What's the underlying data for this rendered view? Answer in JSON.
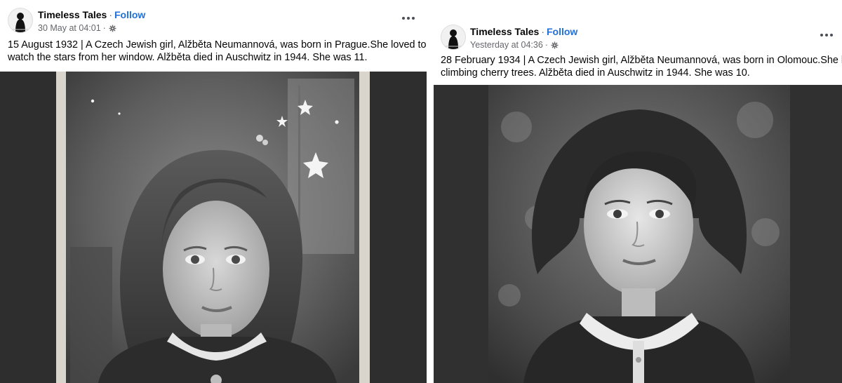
{
  "posts": [
    {
      "page_name": "Timeless Tales",
      "separator": "·",
      "follow_label": "Follow",
      "timestamp": "30 May at 04:01",
      "meta_separator": "·",
      "privacy_icon": "gear-icon",
      "more_icon": "more-options-icon",
      "caption_line1": "15 August 1932 | A Czech Jewish girl, Alžběta Neumannová, was born in Prague.She loved to",
      "caption_line2": "watch the stars from her window. Alžběta died in Auschwitz in 1944. She was 11."
    },
    {
      "page_name": "Timeless Tales",
      "separator": "·",
      "follow_label": "Follow",
      "timestamp": "Yesterday at 04:36",
      "meta_separator": "·",
      "privacy_icon": "gear-icon",
      "more_icon": "more-options-icon",
      "caption_line1": "28 February 1934 | A Czech Jewish girl, Alžběta Neumannová, was born in Olomouc.She loved",
      "caption_line2": "climbing cherry trees. Alžběta died in Auschwitz in 1944. She was 10."
    }
  ],
  "colors": {
    "link_blue": "#216fdb",
    "meta_gray": "#65676b",
    "text_dark": "#050505"
  }
}
